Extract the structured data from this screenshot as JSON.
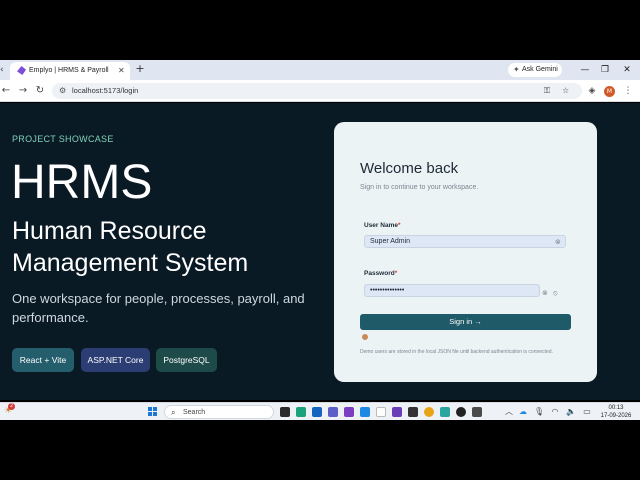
{
  "browser": {
    "tab_title": "Emplyo | HRMS & Payroll",
    "tab_close": "✕",
    "new_tab": "+",
    "gemini_label": "Ask Gemini",
    "url": "localhost:5173/login"
  },
  "hero": {
    "eyebrow": "PROJECT SHOWCASE",
    "title": "HRMS",
    "subtitle": "Human Resource Management System",
    "description": "One workspace for people, processes, payroll, and performance.",
    "chips": [
      {
        "label": "React + Vite",
        "color": "#245e6c"
      },
      {
        "label": "ASP.NET Core",
        "color": "#2c3d73"
      },
      {
        "label": "PostgreSQL",
        "color": "#1f4a4a"
      }
    ]
  },
  "login": {
    "heading": "Welcome back",
    "subheading": "Sign in to continue to your workspace.",
    "username_label": "User Name",
    "username_value": "Super Admin",
    "password_label": "Password",
    "password_value": "••••••••••••••",
    "required_mark": "*",
    "submit_label": "Sign in  →",
    "demo_note": "Demo users are stored in the local JSON file until backend authentication is connected."
  },
  "taskbar": {
    "notification_count": "2",
    "search_label": "Search",
    "time": "00:13",
    "date": "17-09-2026"
  },
  "colors": {
    "page_bg": "#0a1a24",
    "accent": "#7fd0b9",
    "button": "#1f5a68"
  }
}
